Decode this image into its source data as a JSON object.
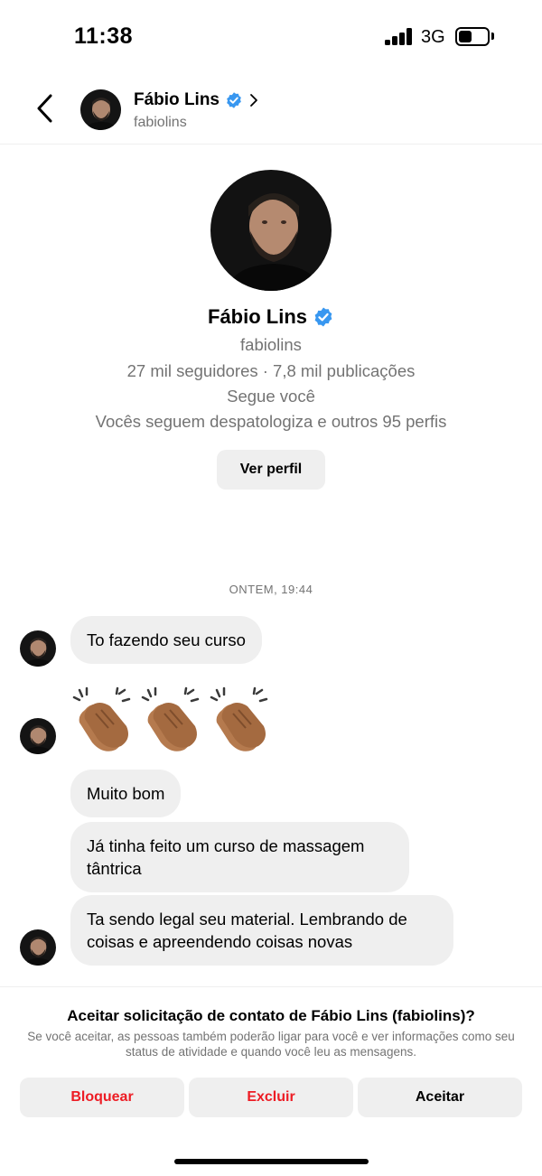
{
  "status_bar": {
    "time": "11:38",
    "network": "3G",
    "battery_level": 0.45
  },
  "header": {
    "name": "Fábio Lins",
    "username": "fabiolins"
  },
  "profile": {
    "name": "Fábio Lins",
    "username": "fabiolins",
    "stats": "27 mil seguidores · 7,8 mil publicações",
    "follows_you": "Segue você",
    "mutuals": "Vocês seguem despatologiza e outros 95 perfis",
    "view_profile_label": "Ver perfil"
  },
  "messages": {
    "timestamp": "ONTEM, 19:44",
    "items": [
      {
        "text": "To fazendo seu curso"
      },
      {
        "text": "👏🏽👏🏽👏🏽"
      },
      {
        "text": "Muito bom"
      },
      {
        "text": "Já tinha feito um curso de massagem tântrica"
      },
      {
        "text": "Ta sendo legal seu material. Lembrando de coisas e apreendendo coisas novas"
      }
    ]
  },
  "request": {
    "title": "Aceitar solicitação de contato de Fábio Lins (fabiolins)?",
    "description": "Se você aceitar, as pessoas também poderão ligar para você e ver informações como seu status de atividade e quando você leu as mensagens.",
    "block_label": "Bloquear",
    "delete_label": "Excluir",
    "accept_label": "Aceitar"
  },
  "colors": {
    "verified": "#3897f0",
    "danger": "#ed1c24",
    "bubble": "#efefef",
    "secondary_text": "#737373"
  },
  "icons": [
    "back-chevron-icon",
    "verified-badge-icon",
    "chevron-right-icon",
    "signal-icon",
    "battery-icon",
    "clapping-hands-icon"
  ]
}
